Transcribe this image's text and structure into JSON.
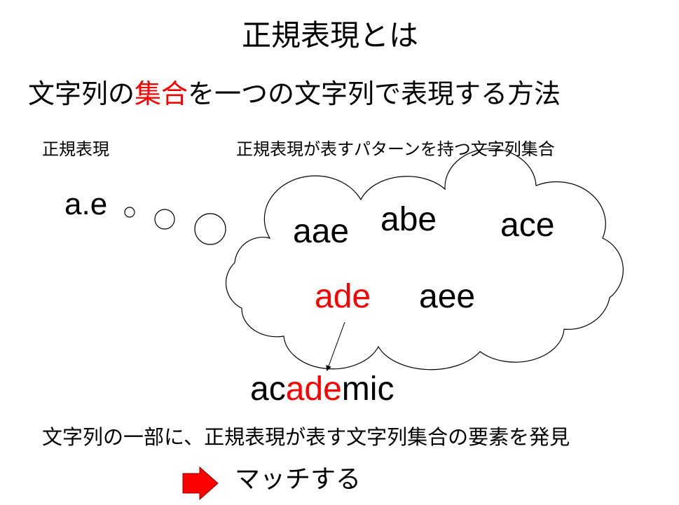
{
  "title": "正規表現とは",
  "subtitle": {
    "p1": "文字列の",
    "p2": "集合",
    "p3": "を一つの文字列で表現する方法"
  },
  "label_regex": "正規表現",
  "label_set": "正規表現が表すパターンを持つ文字列集合",
  "regex": "a.e",
  "cloud_words": [
    "aae",
    "abe",
    "ace",
    "ade",
    "aee"
  ],
  "example": {
    "p1": "ac",
    "p2": "ade",
    "p3": "mic"
  },
  "explanation": "文字列の一部に、正規表現が表す文字列集合の要素を発見",
  "result": "マッチする",
  "colors": {
    "accent": "#ff0000"
  }
}
